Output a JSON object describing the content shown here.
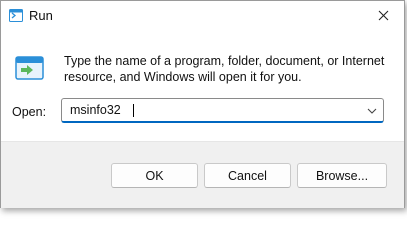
{
  "window": {
    "title": "Run",
    "icon": "run-icon",
    "close_icon": "close-icon"
  },
  "content": {
    "icon": "run-program-icon",
    "description": "Type the name of a program, folder, document, or Internet\nresource, and Windows will open it for you."
  },
  "open_field": {
    "label": "Open:",
    "value": "msinfo32",
    "dropdown_icon": "chevron-down-icon"
  },
  "buttons": {
    "ok": "OK",
    "cancel": "Cancel",
    "browse": "Browse..."
  },
  "colors": {
    "accent": "#0067c0",
    "footer_bg": "#f0f0f0",
    "icon_blue": "#2b8fd8",
    "icon_green": "#5cb85c"
  }
}
